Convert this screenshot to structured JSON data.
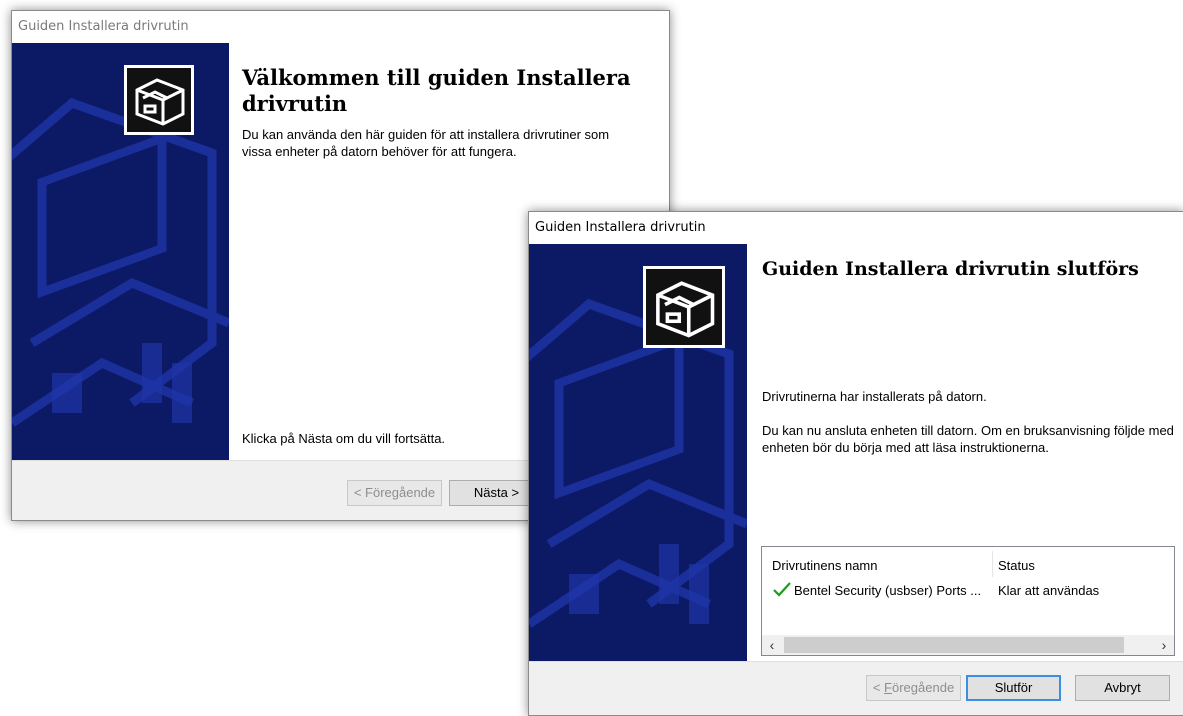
{
  "window1": {
    "title": "Guiden Installera drivrutin",
    "heading": "Välkommen till guiden Installera drivrutin",
    "description": "Du kan använda den här guiden för att installera drivrutiner som vissa enheter på datorn behöver för att fungera.",
    "instruction": "Klicka på Nästa om du vill fortsätta.",
    "buttons": {
      "back": "< Föregående",
      "next": "Nästa >"
    }
  },
  "window2": {
    "title": "Guiden Installera drivrutin",
    "heading": "Guiden Installera drivrutin slutförs",
    "installed": "Drivrutinerna har installerats på datorn.",
    "info": "Du kan nu ansluta enheten till datorn. Om en bruksanvisning följde med enheten bör du börja med att läsa instruktionerna.",
    "table": {
      "columns": [
        "Drivrutinens namn",
        "Status"
      ],
      "rows": [
        {
          "name": "Bentel Security (usbser) Ports ...",
          "status": "Klar att användas",
          "icon": "green-checkmark-icon"
        }
      ]
    },
    "buttons": {
      "back_prefix": "< ",
      "back_accel": "F",
      "back_rest": "öregående",
      "finish": "Slutför",
      "cancel": "Avbryt"
    }
  },
  "colors": {
    "banner": "#0c1a66",
    "accent": "#3c8ee0",
    "check": "#1a9e1a"
  }
}
